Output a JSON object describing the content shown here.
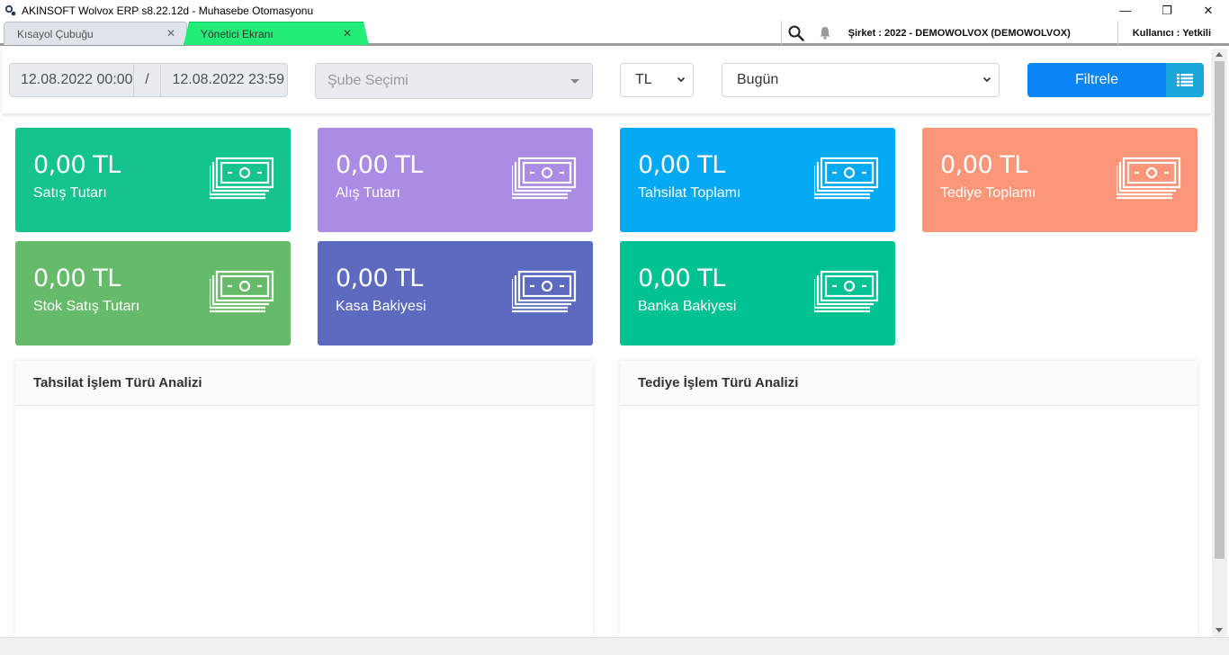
{
  "window": {
    "title": "AKINSOFT Wolvox ERP s8.22.12d - Muhasebe Otomasyonu",
    "minimize": "—",
    "restore": "❐",
    "close": "✕"
  },
  "tabs": [
    {
      "label": "Kısayol Çubuğu",
      "active": false
    },
    {
      "label": "Yönetici Ekranı",
      "active": true
    }
  ],
  "toolbar": {
    "company": "Şirket : 2022 - DEMOWOLVOX (DEMOWOLVOX)",
    "user": "Kullanıcı : Yetkili"
  },
  "filters": {
    "date_start": "12.08.2022 00:00",
    "date_separator": "/",
    "date_end": "12.08.2022 23:59",
    "branch_placeholder": "Şube Seçimi",
    "currency": "TL",
    "period": "Bugün",
    "filter_label": "Filtrele"
  },
  "cards": [
    {
      "value": "0,00 TL",
      "label": "Satış Tutarı",
      "color": "#14c38e"
    },
    {
      "value": "0,00 TL",
      "label": "Alış Tutarı",
      "color": "#ab8ce4"
    },
    {
      "value": "0,00 TL",
      "label": "Tahsilat Toplamı",
      "color": "#03a9f3"
    },
    {
      "value": "0,00 TL",
      "label": "Tediye Toplamı",
      "color": "#fb9678"
    },
    {
      "value": "0,00 TL",
      "label": "Stok Satış Tutarı",
      "color": "#66bb6a"
    },
    {
      "value": "0,00 TL",
      "label": "Kasa Bakiyesi",
      "color": "#5c6bc0"
    },
    {
      "value": "0,00 TL",
      "label": "Banka Bakiyesi",
      "color": "#00c292"
    }
  ],
  "panels": {
    "left_title": "Tahsilat İşlem Türü Analizi",
    "right_title": "Tediye İşlem Türü Analizi"
  }
}
